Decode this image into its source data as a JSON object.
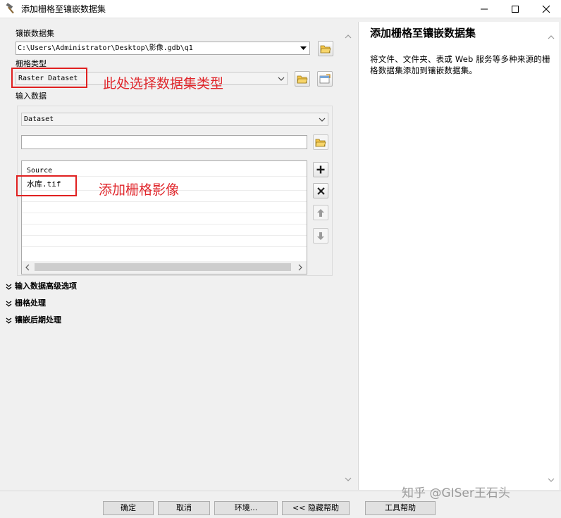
{
  "window": {
    "title": "添加栅格至镶嵌数据集",
    "icon": "hammer-icon",
    "controls": [
      "minimize-icon",
      "maximize-icon",
      "close-icon"
    ]
  },
  "form": {
    "mosaic_label": "镶嵌数据集",
    "mosaic_value": "C:\\Users\\Administrator\\Desktop\\影像.gdb\\q1",
    "raster_type_label": "栅格类型",
    "raster_type_value": "Raster Dataset",
    "input_data_label": "输入数据",
    "input_type_value": "Dataset",
    "input_path_value": "",
    "list_header": "Source",
    "list_items": [
      "水库.tif"
    ]
  },
  "sections": [
    "输入数据高级选项",
    "栅格处理",
    "镶嵌后期处理"
  ],
  "help": {
    "title": "添加栅格至镶嵌数据集",
    "text": "将文件、文件夹、表或 Web 服务等多种来源的栅格数据集添加到镶嵌数据集。"
  },
  "buttons": {
    "ok": "确定",
    "cancel": "取消",
    "env": "环境...",
    "hide_help": "<< 隐藏帮助",
    "tool_help": "工具帮助"
  },
  "annotations": {
    "raster_type_note": "此处选择数据集类型",
    "add_raster_note": "添加栅格影像"
  },
  "watermark": "知乎 @GISer王石头",
  "colors": {
    "annotation_red": "#e0262b",
    "window_bg": "#f0f0f0",
    "panel_white": "#ffffff"
  }
}
